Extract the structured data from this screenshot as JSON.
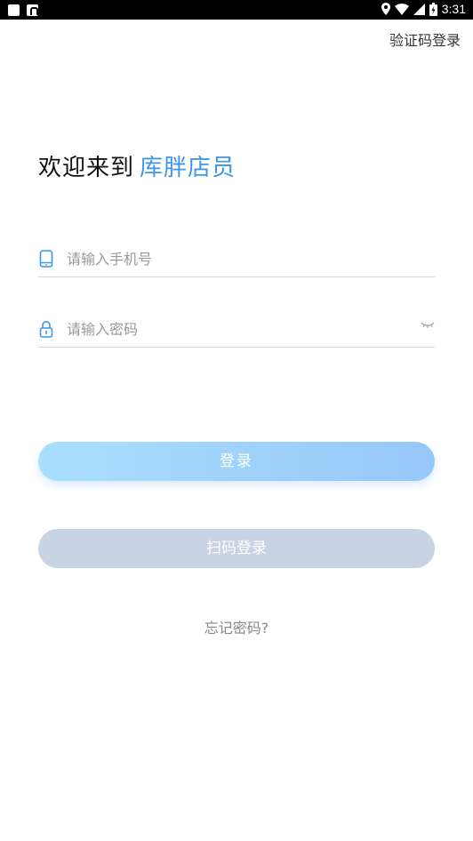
{
  "status_bar": {
    "time": "3:31",
    "icons": [
      "notification-square-icon",
      "a-notification-icon",
      "location-icon",
      "wifi-icon",
      "signal-icon",
      "battery-icon"
    ]
  },
  "header": {
    "sms_login_link": "验证码登录"
  },
  "welcome": {
    "prefix": "欢迎来到",
    "brand": "库胖店员",
    "brand_color": "#3d96e8"
  },
  "form": {
    "phone_placeholder": "请输入手机号",
    "password_placeholder": "请输入密码",
    "icon_color": "#3d96e8"
  },
  "buttons": {
    "login_label": "登录",
    "scan_login_label": "扫码登录"
  },
  "forgot_password": "忘记密码?"
}
